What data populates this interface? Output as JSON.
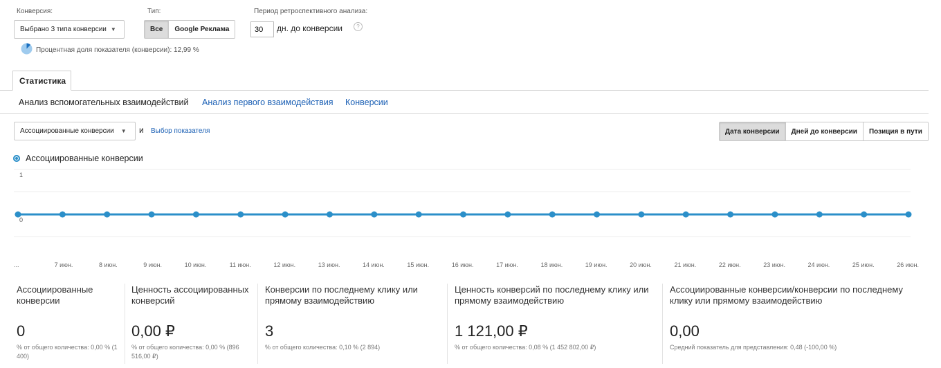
{
  "filters": {
    "conversion_label": "Конверсия:",
    "conversion_value": "Выбрано 3 типа конверсии",
    "type_label": "Тип:",
    "type_options": [
      "Все",
      "Google Реклама"
    ],
    "type_active": "Все",
    "lookback_label": "Период ретроспективного анализа:",
    "lookback_value": "30",
    "lookback_suffix": "дн. до конверсии",
    "help_icon": "?",
    "sample_text": "Процентная доля показателя (конверсии): 12,99 %"
  },
  "tabs": {
    "main_tab": "Статистика"
  },
  "subnav": {
    "items": [
      "Анализ вспомогательных взаимодействий",
      "Анализ первого взаимодействия",
      "Конверсии"
    ]
  },
  "controls": {
    "metric_dropdown": "Ассоциированные конверсии",
    "and_label": "и",
    "select_metric_link": "Выбор показателя",
    "view_buttons": [
      "Дата конверсии",
      "Дней до конверсии",
      "Позиция в пути"
    ],
    "view_active": "Дата конверсии"
  },
  "chart_data": {
    "type": "line",
    "series": [
      {
        "name": "Ассоциированные конверсии",
        "values": [
          0,
          0,
          0,
          0,
          0,
          0,
          0,
          0,
          0,
          0,
          0,
          0,
          0,
          0,
          0,
          0,
          0,
          0,
          0,
          0,
          0
        ]
      }
    ],
    "x": [
      "...",
      "7 июн.",
      "8 июн.",
      "9 июн.",
      "10 июн.",
      "11 июн.",
      "12 июн.",
      "13 июн.",
      "14 июн.",
      "15 июн.",
      "16 июн.",
      "17 июн.",
      "18 июн.",
      "19 июн.",
      "20 июн.",
      "21 июн.",
      "22 июн.",
      "23 июн.",
      "24 июн.",
      "25 июн.",
      "26 июн."
    ],
    "y_ticks": [
      "1",
      "0"
    ],
    "ylim": [
      -1,
      1
    ],
    "color": "#2b8fc9",
    "grid": true,
    "legend": "top-left"
  },
  "metrics": [
    {
      "title": "Ассоциированные конверсии",
      "value": "0",
      "sub": "% от общего количества: 0,00 % (1 400)"
    },
    {
      "title": "Ценность ассоциированных конверсий",
      "value": "0,00 ₽",
      "sub": "% от общего количества: 0,00 % (896 516,00 ₽)"
    },
    {
      "title": "Конверсии по последнему клику или прямому взаимодействию",
      "value": "3",
      "sub": "% от общего количества: 0,10 % (2 894)"
    },
    {
      "title": "Ценность конверсий по последнему клику или прямому взаимодействию",
      "value": "1 121,00 ₽",
      "sub": "% от общего количества: 0,08 % (1 452 802,00 ₽)"
    },
    {
      "title": "Ассоциированные конверсии/конверсии по последнему клику или прямому взаимодействию",
      "value": "0,00",
      "sub": "Средний показатель для представления: 0,48 (-100,00 %)"
    }
  ]
}
